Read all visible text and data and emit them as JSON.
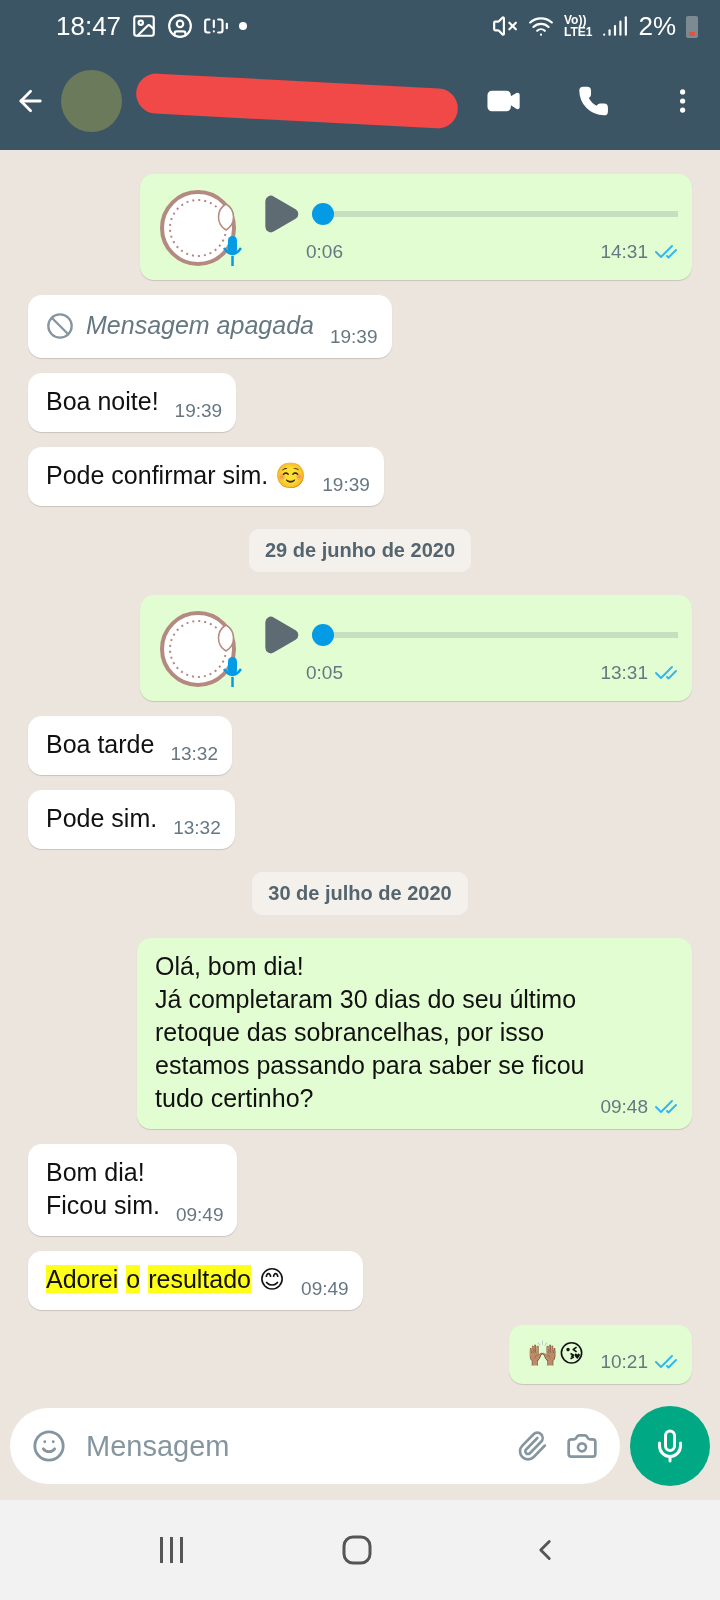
{
  "status_bar": {
    "time": "18:47",
    "network_label": [
      "Vo))",
      "LTE1"
    ],
    "battery": "2%"
  },
  "header": {
    "name_redacted": true
  },
  "messages": [
    {
      "kind": "audio",
      "outgoing": true,
      "duration": "0:06",
      "time": "14:31",
      "read": true,
      "level": 0
    },
    {
      "kind": "deleted",
      "outgoing": false,
      "text": "Mensagem apagada",
      "time": "19:39"
    },
    {
      "kind": "text",
      "outgoing": false,
      "segments": [
        {
          "text": "Boa noite!",
          "highlighted": false
        }
      ],
      "time": "19:39"
    },
    {
      "kind": "text",
      "outgoing": false,
      "segments": [
        {
          "text": "Pode confirmar sim. ☺️",
          "highlighted": false
        }
      ],
      "time": "19:39"
    },
    {
      "kind": "date",
      "text": "29 de junho de 2020"
    },
    {
      "kind": "audio",
      "outgoing": true,
      "duration": "0:05",
      "time": "13:31",
      "read": true,
      "level": 0
    },
    {
      "kind": "text",
      "outgoing": false,
      "segments": [
        {
          "text": "Boa tarde",
          "highlighted": false
        }
      ],
      "time": "13:32"
    },
    {
      "kind": "text",
      "outgoing": false,
      "segments": [
        {
          "text": "Pode sim.",
          "highlighted": false
        }
      ],
      "time": "13:32"
    },
    {
      "kind": "date",
      "text": "30 de julho de 2020"
    },
    {
      "kind": "text",
      "outgoing": true,
      "read": true,
      "segments": [
        {
          "text": "Olá, bom dia!\nJá completaram 30 dias do seu último\nretoque das sobrancelhas, por isso\nestamos passando para saber se ficou\ntudo certinho?",
          "highlighted": false
        }
      ],
      "time": "09:48"
    },
    {
      "kind": "text",
      "outgoing": false,
      "segments": [
        {
          "text": "Bom dia!\nFicou sim.",
          "highlighted": false
        }
      ],
      "time": "09:49"
    },
    {
      "kind": "text",
      "outgoing": false,
      "segments": [
        {
          "text": "Adorei",
          "highlighted": true
        },
        {
          "text": "o",
          "highlighted": true
        },
        {
          "text": "resultado",
          "highlighted": true
        },
        {
          "text": "😊",
          "highlighted": false
        }
      ],
      "time": "09:49"
    },
    {
      "kind": "text",
      "outgoing": true,
      "read": true,
      "segments": [
        {
          "text": "🙌🏽😘",
          "highlighted": false
        }
      ],
      "time": "10:21"
    }
  ],
  "composer": {
    "placeholder": "Mensagem"
  }
}
